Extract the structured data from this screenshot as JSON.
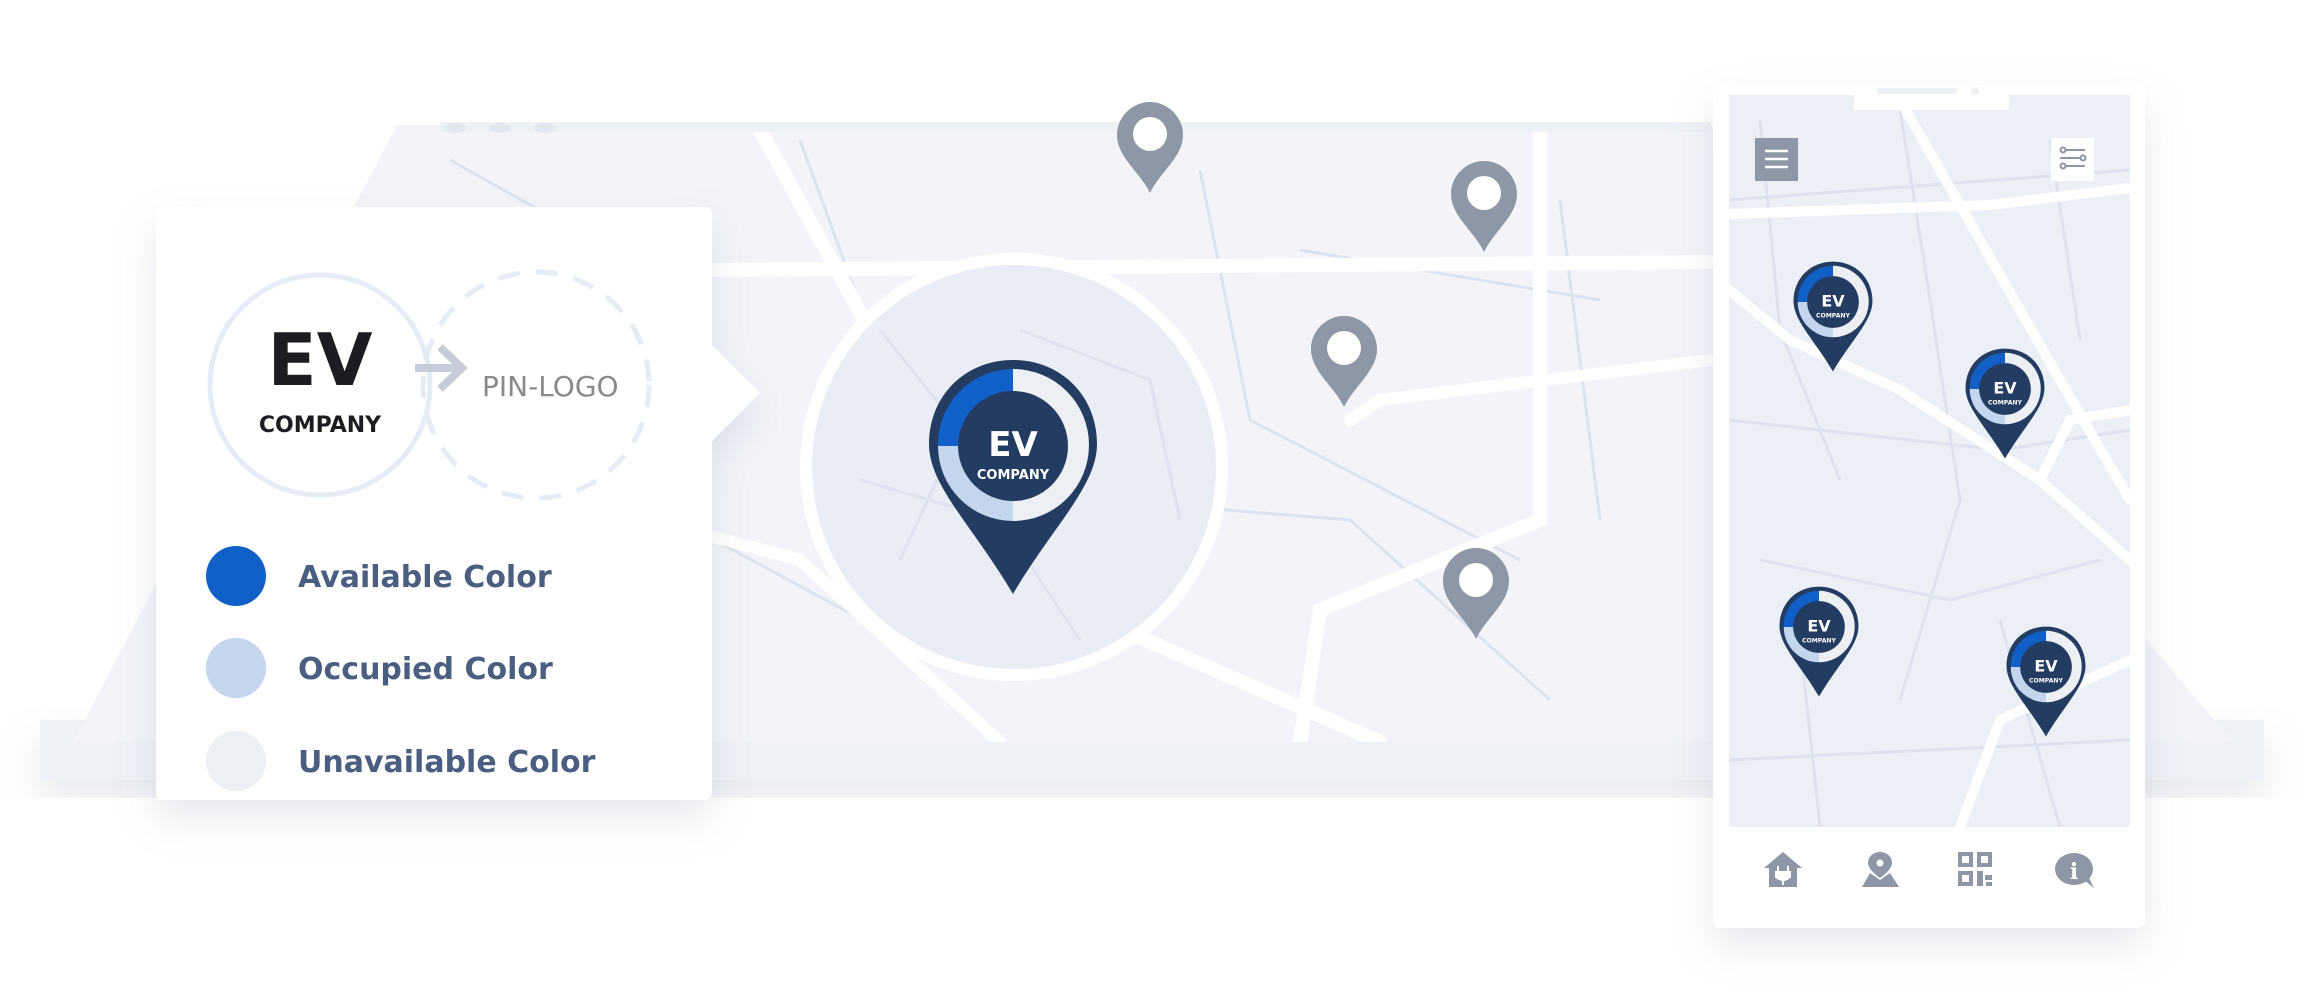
{
  "logo": {
    "brand": "EV",
    "subtitle": "COMPANY"
  },
  "pin_logo_label": "PIN-LOGO",
  "legend": [
    {
      "label": "Available Color",
      "color": "#1060c8"
    },
    {
      "label": "Occupied Color",
      "color": "#c3d6ee"
    },
    {
      "label": "Unavailable Color",
      "color": "#eceff3"
    }
  ],
  "colors": {
    "pin_body": "#243c62",
    "map_bg": "#f2f4f9",
    "generic_pin": "#8e97a5",
    "icon_gray": "#8e97a5"
  },
  "featured_pin": {
    "brand": "EV",
    "subtitle": "COMPANY"
  },
  "phone": {
    "top_left_button": "menu-icon",
    "top_right_button": "filter-sliders-icon",
    "pins": [
      {
        "brand": "EV",
        "subtitle": "COMPANY"
      },
      {
        "brand": "EV",
        "subtitle": "COMPANY"
      },
      {
        "brand": "EV",
        "subtitle": "COMPANY"
      },
      {
        "brand": "EV",
        "subtitle": "COMPANY"
      }
    ],
    "nav": [
      "home-charger-icon",
      "map-location-icon",
      "qr-code-icon",
      "info-chat-icon"
    ]
  }
}
